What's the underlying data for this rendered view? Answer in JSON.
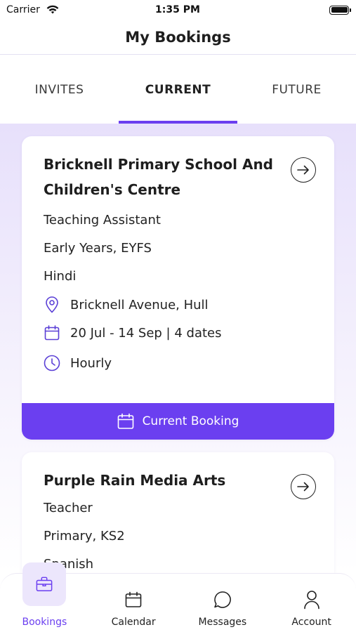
{
  "status": {
    "carrier": "Carrier",
    "time": "1:35 PM"
  },
  "header": {
    "title": "My Bookings"
  },
  "tabs": [
    {
      "label": "INVITES"
    },
    {
      "label": "CURRENT"
    },
    {
      "label": "FUTURE"
    }
  ],
  "bookings": [
    {
      "title": "Bricknell Primary School And Children's Centre",
      "role": "Teaching Assistant",
      "phase": "Early Years, EYFS",
      "language": "Hindi",
      "location": "Bricknell Avenue, Hull",
      "dates": "20 Jul - 14 Sep | 4 dates",
      "pay_type": "Hourly",
      "button_label": "Current Booking"
    },
    {
      "title": "Purple Rain Media Arts",
      "role": "Teacher",
      "phase": "Primary, KS2",
      "language": "Spanish"
    }
  ],
  "nav": [
    {
      "label": "Bookings"
    },
    {
      "label": "Calendar"
    },
    {
      "label": "Messages"
    },
    {
      "label": "Account"
    }
  ],
  "colors": {
    "accent": "#6b3ff0",
    "background_tint": "#e7e0fb"
  }
}
